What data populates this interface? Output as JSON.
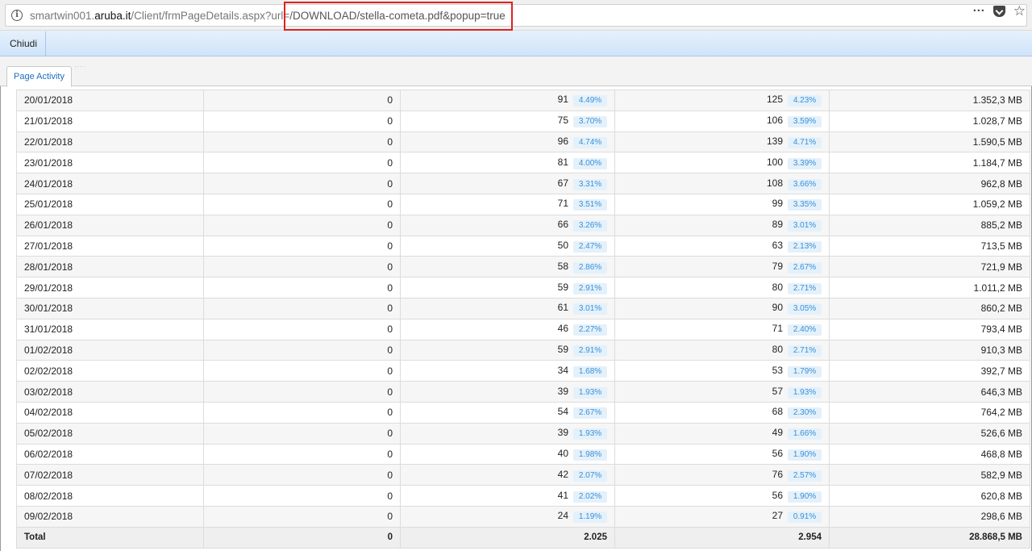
{
  "browser": {
    "url_prefix": "smartwin001.",
    "url_domain": "aruba.it",
    "url_path": "/Client/frmPageDetails.aspx?url=",
    "url_highlighted": "/DOWNLOAD/stella-cometa.pdf&popup=true",
    "menu_icon": "more-dots-icon",
    "pocket_icon": "pocket-icon",
    "bookmark_icon": "star-icon"
  },
  "toolbar": {
    "close_label": "Chiudi"
  },
  "tabs": [
    {
      "label": "Page Activity"
    }
  ],
  "table": {
    "rows": [
      {
        "date": "20/01/2018",
        "zero": "0",
        "v": "91",
        "vp": "4.49%",
        "h": "125",
        "hp": "4.23%",
        "bw": "1.352,3 MB"
      },
      {
        "date": "21/01/2018",
        "zero": "0",
        "v": "75",
        "vp": "3.70%",
        "h": "106",
        "hp": "3.59%",
        "bw": "1.028,7 MB"
      },
      {
        "date": "22/01/2018",
        "zero": "0",
        "v": "96",
        "vp": "4.74%",
        "h": "139",
        "hp": "4.71%",
        "bw": "1.590,5 MB"
      },
      {
        "date": "23/01/2018",
        "zero": "0",
        "v": "81",
        "vp": "4.00%",
        "h": "100",
        "hp": "3.39%",
        "bw": "1.184,7 MB"
      },
      {
        "date": "24/01/2018",
        "zero": "0",
        "v": "67",
        "vp": "3.31%",
        "h": "108",
        "hp": "3.66%",
        "bw": "962,8 MB"
      },
      {
        "date": "25/01/2018",
        "zero": "0",
        "v": "71",
        "vp": "3.51%",
        "h": "99",
        "hp": "3.35%",
        "bw": "1.059,2 MB"
      },
      {
        "date": "26/01/2018",
        "zero": "0",
        "v": "66",
        "vp": "3.26%",
        "h": "89",
        "hp": "3.01%",
        "bw": "885,2 MB"
      },
      {
        "date": "27/01/2018",
        "zero": "0",
        "v": "50",
        "vp": "2.47%",
        "h": "63",
        "hp": "2.13%",
        "bw": "713,5 MB"
      },
      {
        "date": "28/01/2018",
        "zero": "0",
        "v": "58",
        "vp": "2.86%",
        "h": "79",
        "hp": "2.67%",
        "bw": "721,9 MB"
      },
      {
        "date": "29/01/2018",
        "zero": "0",
        "v": "59",
        "vp": "2.91%",
        "h": "80",
        "hp": "2.71%",
        "bw": "1.011,2 MB"
      },
      {
        "date": "30/01/2018",
        "zero": "0",
        "v": "61",
        "vp": "3.01%",
        "h": "90",
        "hp": "3.05%",
        "bw": "860,2 MB"
      },
      {
        "date": "31/01/2018",
        "zero": "0",
        "v": "46",
        "vp": "2.27%",
        "h": "71",
        "hp": "2.40%",
        "bw": "793,4 MB"
      },
      {
        "date": "01/02/2018",
        "zero": "0",
        "v": "59",
        "vp": "2.91%",
        "h": "80",
        "hp": "2.71%",
        "bw": "910,3 MB"
      },
      {
        "date": "02/02/2018",
        "zero": "0",
        "v": "34",
        "vp": "1.68%",
        "h": "53",
        "hp": "1.79%",
        "bw": "392,7 MB"
      },
      {
        "date": "03/02/2018",
        "zero": "0",
        "v": "39",
        "vp": "1.93%",
        "h": "57",
        "hp": "1.93%",
        "bw": "646,3 MB"
      },
      {
        "date": "04/02/2018",
        "zero": "0",
        "v": "54",
        "vp": "2.67%",
        "h": "68",
        "hp": "2.30%",
        "bw": "764,2 MB"
      },
      {
        "date": "05/02/2018",
        "zero": "0",
        "v": "39",
        "vp": "1.93%",
        "h": "49",
        "hp": "1.66%",
        "bw": "526,6 MB"
      },
      {
        "date": "06/02/2018",
        "zero": "0",
        "v": "40",
        "vp": "1.98%",
        "h": "56",
        "hp": "1.90%",
        "bw": "468,8 MB"
      },
      {
        "date": "07/02/2018",
        "zero": "0",
        "v": "42",
        "vp": "2.07%",
        "h": "76",
        "hp": "2.57%",
        "bw": "582,9 MB"
      },
      {
        "date": "08/02/2018",
        "zero": "0",
        "v": "41",
        "vp": "2.02%",
        "h": "56",
        "hp": "1.90%",
        "bw": "620,8 MB"
      },
      {
        "date": "09/02/2018",
        "zero": "0",
        "v": "24",
        "vp": "1.19%",
        "h": "27",
        "hp": "0.91%",
        "bw": "298,6 MB"
      }
    ],
    "total": {
      "label": "Total",
      "zero": "0",
      "v": "2.025",
      "h": "2.954",
      "bw": "28.868,5 MB"
    }
  }
}
